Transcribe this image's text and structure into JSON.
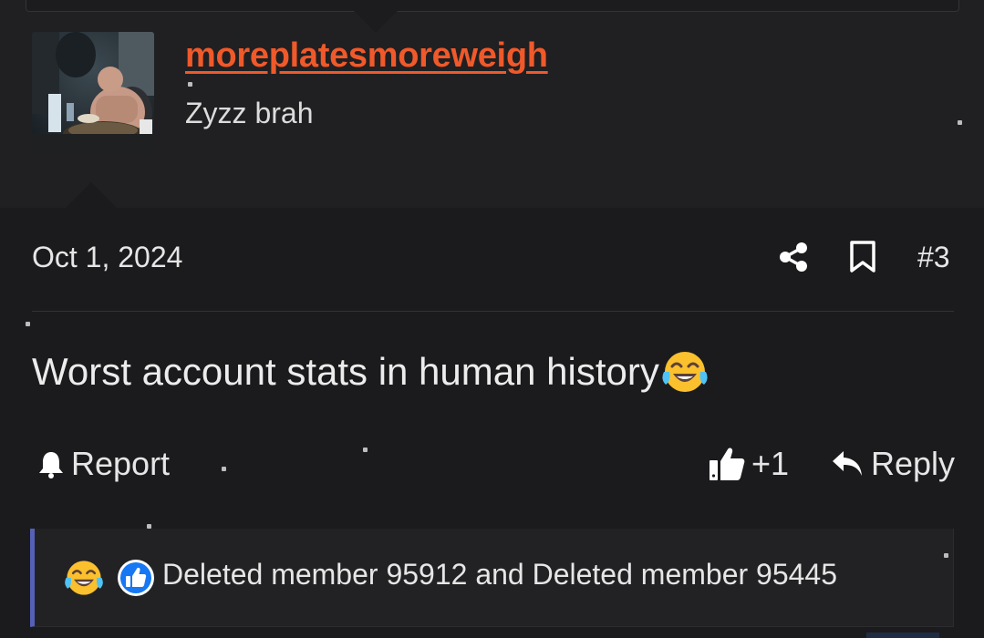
{
  "post": {
    "author": "moreplatesmoreweigh",
    "author_title": "Zyzz brah",
    "date": "Oct 1, 2024",
    "number": "#3",
    "body": "Worst account stats in human history",
    "body_emoji": "face-with-tears-of-joy-icon"
  },
  "actions": {
    "report": "Report",
    "like_count": "+1",
    "reply": "Reply"
  },
  "reactions": {
    "icons": [
      "face-with-tears-of-joy-icon",
      "like-icon"
    ],
    "users_text": "Deleted member 95912 and Deleted member 95445"
  },
  "colors": {
    "background": "#1b1b1d",
    "username": "#f0592a",
    "reaction_accent": "#5560b6",
    "like_blue": "#1877f2"
  }
}
